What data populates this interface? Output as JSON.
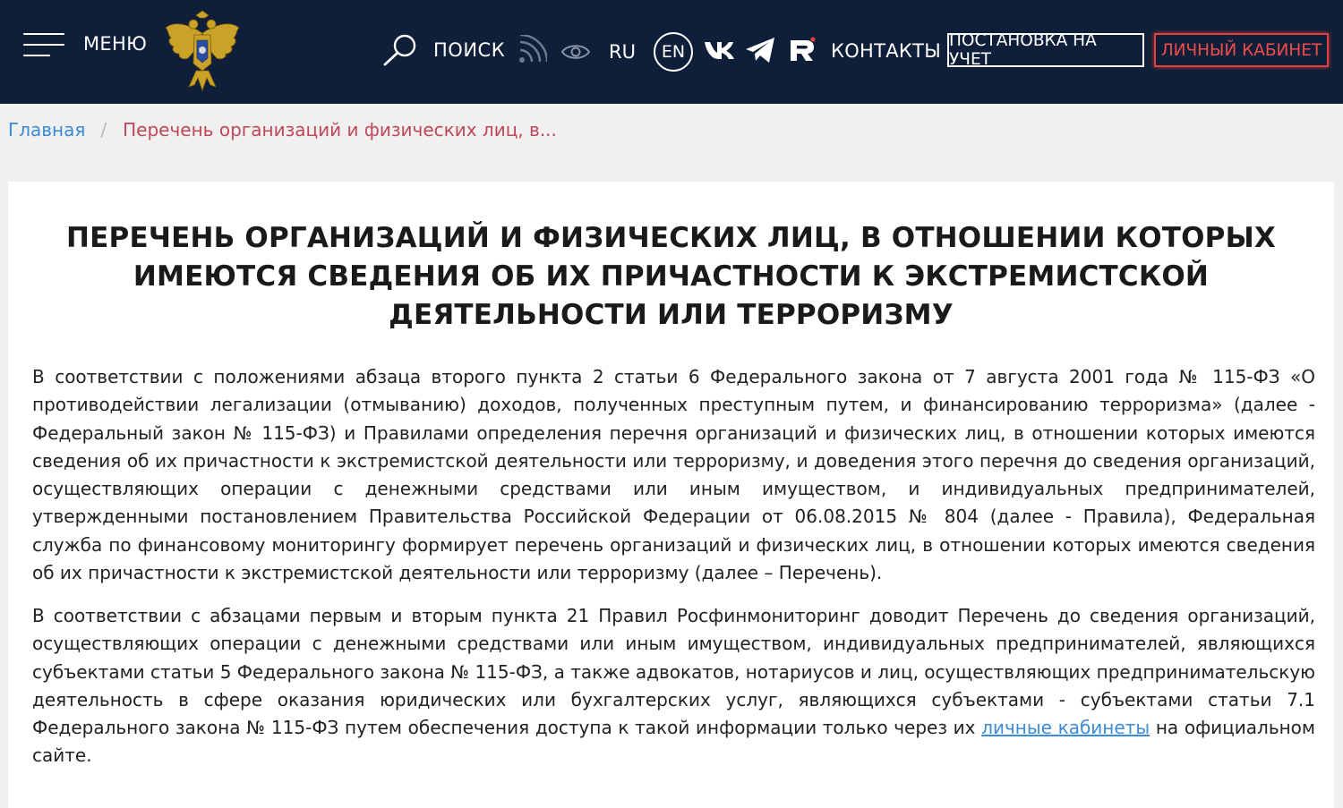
{
  "header": {
    "menu_label": "МЕНЮ",
    "search_label": "ПОИСК",
    "lang_ru": "RU",
    "lang_en": "EN",
    "contacts_label": "КОНТАКТЫ",
    "registration_button": "ПОСТАНОВКА НА УЧЕТ",
    "cabinet_button": "ЛИЧНЫЙ КАБИНЕТ",
    "icons": [
      "menu-icon",
      "emblem-logo",
      "search-icon",
      "rss-icon",
      "eye-icon",
      "vk-icon",
      "telegram-icon",
      "rutube-icon"
    ],
    "colors": {
      "background": "#0f1f3a",
      "cabinet_accent": "#e2403f"
    }
  },
  "breadcrumb": {
    "home": "Главная",
    "separator": "/",
    "current": "Перечень организаций и физических лиц, в..."
  },
  "main": {
    "title": "ПЕРЕЧЕНЬ ОРГАНИЗАЦИЙ И ФИЗИЧЕСКИХ ЛИЦ, В ОТНОШЕНИИ КОТОРЫХ ИМЕЮТСЯ СВЕДЕНИЯ ОБ ИХ ПРИЧАСТНОСТИ К ЭКСТРЕМИСТСКОЙ ДЕЯТЕЛЬНОСТИ ИЛИ ТЕРРОРИЗМУ",
    "paragraph1": "В соответствии с положениями абзаца второго пункта 2 статьи 6 Федерального закона от 7 августа 2001 года № 115-ФЗ «О противодействии легализации (отмыванию) доходов, полученных преступным путем, и финансированию терроризма» (далее - Федеральный закон № 115-ФЗ) и Правилами определения перечня организаций и физических лиц, в отношении которых имеются сведения об их причастности к экстремистской деятельности или терроризму, и доведения этого перечня до сведения организаций, осуществляющих операции с денежными средствами или иным имуществом, и индивидуальных предпринимателей, утвержденными постановлением Правительства Российской Федерации от 06.08.2015 № 804 (далее - Правила), Федеральная служба по финансовому мониторингу формирует перечень организаций и физических лиц, в отношении которых имеются сведения об их причастности к экстремистской деятельности или терроризму (далее – Перечень).",
    "paragraph2_before_link": "В соответствии с абзацами первым и вторым пункта 21 Правил Росфинмониторинг доводит Перечень до сведения организаций, осуществляющих операции с денежными средствами или иным имуществом, индивидуальных предпринимателей, являющихся субъектами статьи 5 Федерального закона № 115-ФЗ, а также адвокатов, нотариусов и лиц, осуществляющих предпринимательскую деятельность в сфере оказания юридических или бухгалтерских услуг, являющихся субъектами - субъектами статьи 7.1 Федерального закона № 115-ФЗ путем обеспечения доступа к такой информации только через их",
    "paragraph2_link": "личные кабинеты",
    "paragraph2_after_link": "на официальном сайте."
  }
}
